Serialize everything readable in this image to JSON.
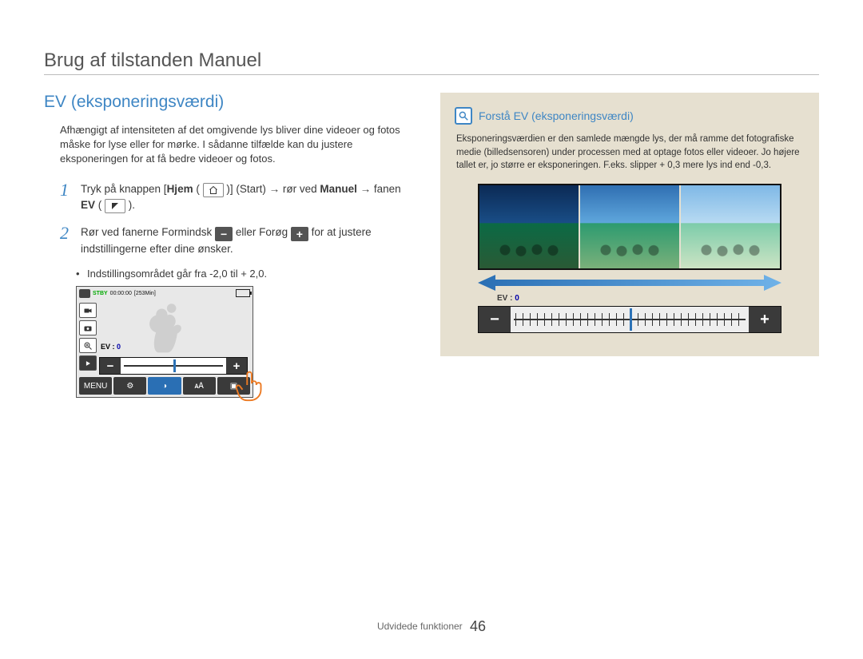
{
  "page_title": "Brug af tilstanden Manuel",
  "section_heading": "EV (eksponeringsværdi)",
  "intro_text": "Afhængigt af intensiteten af det omgivende lys bliver dine videoer og fotos måske for lyse eller for mørke. I sådanne tilfælde kan du justere eksponeringen for at få bedre videoer og fotos.",
  "steps": {
    "s1": {
      "num": "1",
      "prefix": "Tryk på knappen [",
      "hjem": "Hjem",
      "mid1": " ( ",
      "mid2": " )] (Start) → rør ved ",
      "manuel": "Manuel",
      "mid3": " → fanen ",
      "ev": "EV",
      "suffix": " ( "
    },
    "s2": {
      "num": "2",
      "prefix": "Rør ved fanerne Formindsk ",
      "mid": " eller Forøg ",
      "suffix": " for at justere indstillingerne efter dine ønsker."
    }
  },
  "bullet_text": "Indstillingsområdet går fra -2,0 til + 2,0.",
  "camui": {
    "stby": "STBY",
    "time": "00:00:00",
    "remain": "[253Min]",
    "ev_label": "EV :",
    "ev_value": "0",
    "minus": "−",
    "plus": "+",
    "tabs": [
      "MENU",
      "⚙",
      "◑",
      "🗚",
      "▣"
    ]
  },
  "info": {
    "title": "Forstå EV (eksponeringsværdi)",
    "body": "Eksponeringsværdien er den samlede mængde lys, der må ramme det fotografiske medie (billedsensoren) under processen med at optage fotos eller videoer. Jo højere tallet er, jo større er eksponeringen. F.eks. slipper + 0,3 mere lys ind end -0,3.",
    "ev_label": "EV :",
    "ev_value": "0",
    "minus": "−",
    "plus": "+"
  },
  "footer": {
    "section": "Udvidede funktioner",
    "page": "46"
  }
}
